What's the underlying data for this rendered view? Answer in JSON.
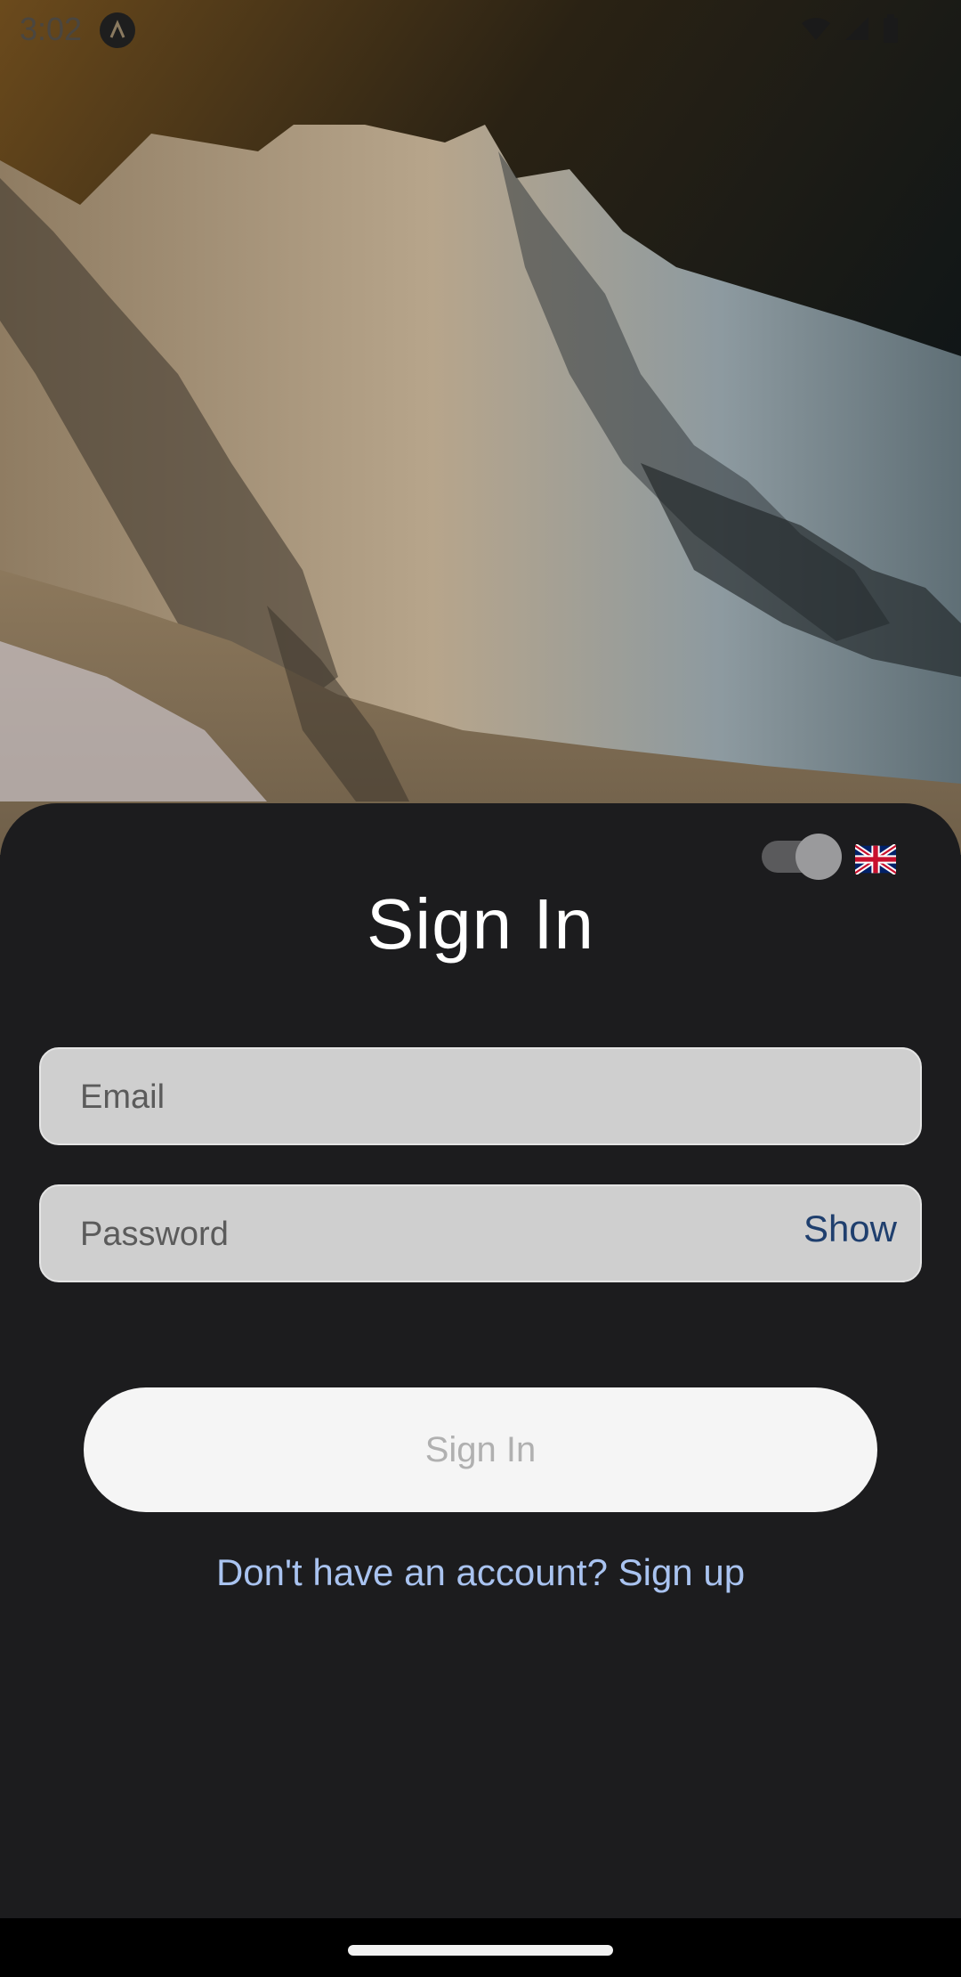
{
  "status_bar": {
    "time": "3:02",
    "icons": [
      "app-notification-icon",
      "wifi-icon",
      "signal-icon",
      "battery-icon"
    ]
  },
  "header": {
    "toggle_state": "on",
    "language_flag": "uk-flag-icon"
  },
  "form": {
    "title": "Sign In",
    "email_placeholder": "Email",
    "email_value": "",
    "password_placeholder": "Password",
    "password_value": "",
    "show_label": "Show",
    "submit_label": "Sign In",
    "signup_text": "Don't have an account? Sign up"
  },
  "colors": {
    "sheet_background": "#1c1c1e",
    "field_background": "#cfcfcf",
    "show_link": "#1f3f6e",
    "signup_link": "#a9c3f0",
    "button_background": "#f5f5f5",
    "button_text": "#b0b0b0"
  }
}
